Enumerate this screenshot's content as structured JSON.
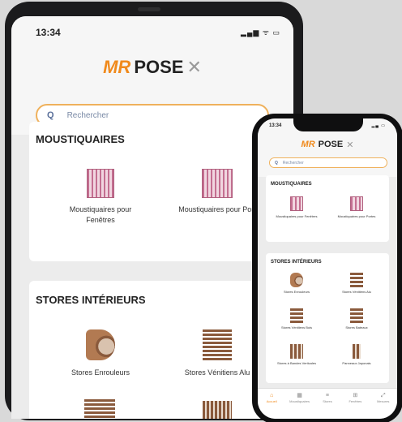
{
  "tablet": {
    "status": {
      "time": "13:34",
      "icons": "▂▄▆ ᯤ ▭"
    },
    "logo": {
      "mr": "MR",
      "pose": "POSE",
      "x": "✕"
    },
    "search": {
      "icon": "Q",
      "placeholder": "Rechercher"
    },
    "sections": [
      {
        "title": "MOUSTIQUAIRES",
        "items": [
          "Moustiquaires pour Fenêtres",
          "Moustiquaires pour Port"
        ]
      },
      {
        "title": "STORES INTÉRIEURS",
        "items": [
          "Stores Enrouleurs",
          "Stores Vénitiens Alu"
        ]
      }
    ]
  },
  "phone": {
    "status": {
      "time": "13:34",
      "icons": "▂▄ ▭"
    },
    "logo": {
      "mr": "MR",
      "pose": "POSE",
      "x": "✕"
    },
    "search": {
      "icon": "Q",
      "placeholder": "Rechercher"
    },
    "sections": [
      {
        "title": "MOUSTIQUAIRES",
        "items": [
          "Moustiquaires pour Fenêtres",
          "Moustiquaires pour Portes"
        ]
      },
      {
        "title": "STORES INTÉRIEURS",
        "items": [
          "Stores Enrouleurs",
          "Stores Vénitiens Alu",
          "Stores Vénitiens Bois",
          "Stores Bateaux",
          "Stores à Bandes Verticales",
          "Panneaux Japonais"
        ]
      }
    ],
    "nav": [
      {
        "label": "Accueil",
        "icon": "home-icon",
        "glyph": "⌂"
      },
      {
        "label": "Moustiquaires",
        "icon": "net-icon",
        "glyph": "▦"
      },
      {
        "label": "Stores",
        "icon": "blind-icon",
        "glyph": "≡"
      },
      {
        "label": "Fenêtres",
        "icon": "window-icon",
        "glyph": "⊞"
      },
      {
        "label": "Mesures",
        "icon": "ruler-icon",
        "glyph": "⤢"
      }
    ]
  },
  "colors": {
    "accent": "#f08a1c",
    "search_border": "#efb15c",
    "icon_brown": "#8a5a3c",
    "icon_pink": "#c46f91"
  }
}
